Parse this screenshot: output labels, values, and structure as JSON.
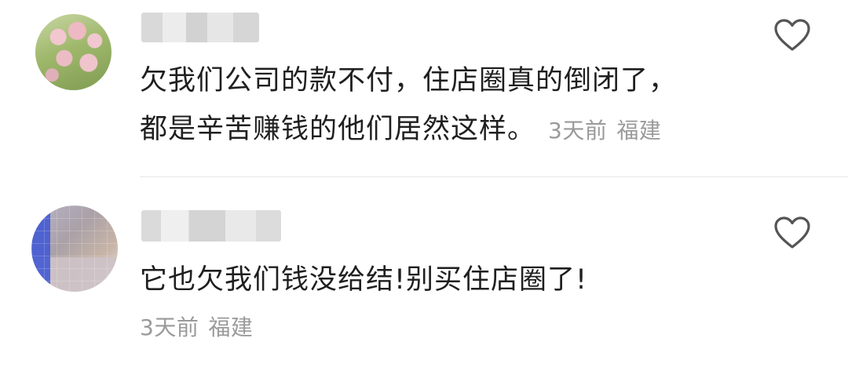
{
  "comments": [
    {
      "text_line1": "欠我们公司的款不付，住店圈真的倒闭了，",
      "text_line2": "都是辛苦赚钱的他们居然这样。",
      "time": "3天前",
      "location": "福建",
      "like_icon": "heart-outline-icon"
    },
    {
      "text": "它也欠我们钱没给结!别买住店圈了!",
      "time": "3天前",
      "location": "福建",
      "like_icon": "heart-outline-icon"
    }
  ],
  "colors": {
    "text": "#1f1f1f",
    "meta": "#9a9a9a",
    "divider": "#e6e6e6",
    "icon": "#555555"
  }
}
